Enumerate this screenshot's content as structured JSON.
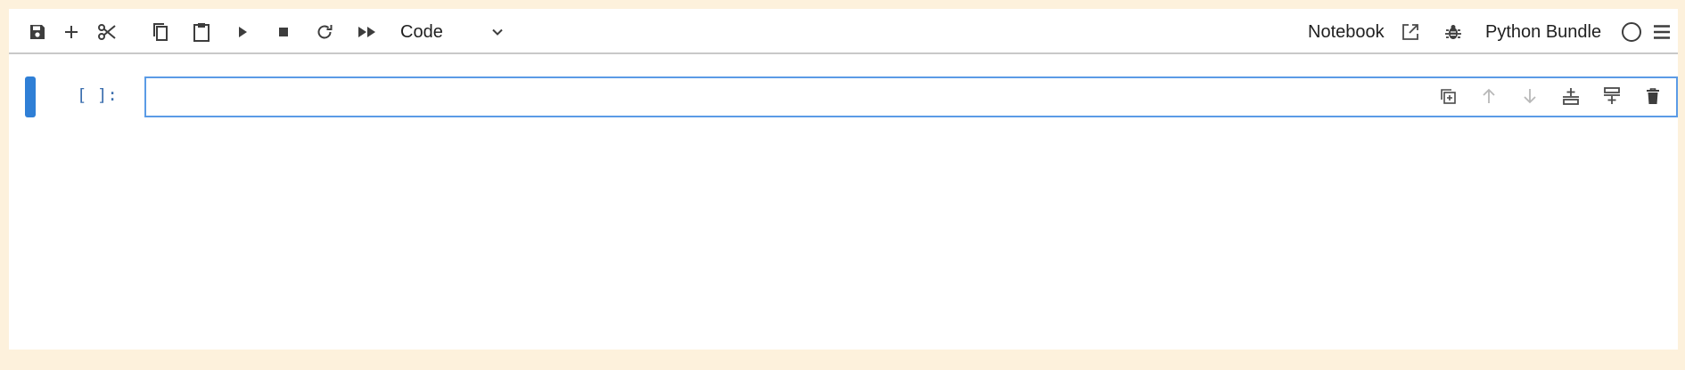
{
  "toolbar": {
    "cell_type": "Code",
    "notebook_label": "Notebook",
    "kernel_label": "Python Bundle",
    "icons": [
      "save-icon",
      "plus-icon",
      "scissors-icon",
      "copy-icon",
      "clipboard-icon",
      "play-icon",
      "stop-icon",
      "restart-icon",
      "fast-forward-icon",
      "chevron-down-icon",
      "external-link-icon",
      "bug-icon",
      "kernel-status-circle-icon",
      "menu-icon"
    ]
  },
  "cell": {
    "prompt": "[ ]:",
    "value": "",
    "tools": [
      "duplicate-icon",
      "move-up-icon",
      "move-down-icon",
      "insert-below-icon",
      "insert-above-icon",
      "delete-icon"
    ]
  },
  "colors": {
    "outer_background": "#fdf1dc",
    "active_bar": "#2f7fd6",
    "cell_border": "#5b9be6",
    "prompt": "#3c6fae",
    "icon": "#4a4a4a",
    "icon_disabled": "#b8b8b8"
  }
}
